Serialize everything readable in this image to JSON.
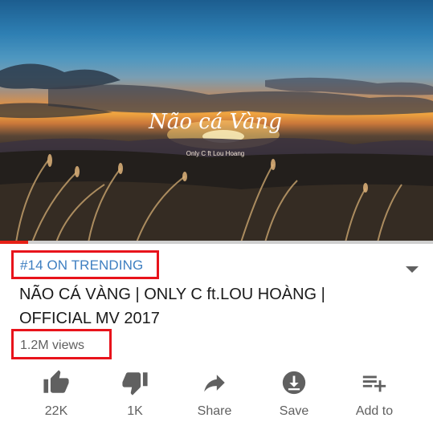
{
  "player": {
    "artwork_title": "Não cá Vàng",
    "artwork_subtitle": "Only C ft Lou Hoang",
    "progress": 0.065
  },
  "video": {
    "trending_badge": "#14 ON TRENDING",
    "title": "NÃO CÁ VÀNG | ONLY C ft.LOU HOÀNG | OFFICIAL MV 2017",
    "views": "1.2M views"
  },
  "actions": {
    "like": {
      "label": "22K",
      "icon": "thumbs-up-icon"
    },
    "dislike": {
      "label": "1K",
      "icon": "thumbs-down-icon"
    },
    "share": {
      "label": "Share",
      "icon": "share-icon"
    },
    "save": {
      "label": "Save",
      "icon": "download-icon"
    },
    "add": {
      "label": "Add to",
      "icon": "add-to-playlist-icon"
    }
  },
  "colors": {
    "trending_text": "#3e7fc1",
    "highlight_border": "#e8131b",
    "progress": "#e62117",
    "icon": "#606060"
  }
}
